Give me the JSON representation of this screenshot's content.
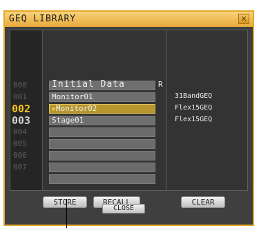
{
  "window": {
    "title": "GEQ LIBRARY"
  },
  "library": {
    "rows": [
      {
        "num": "000",
        "name": "Initial Data",
        "flag": "R",
        "type": "",
        "state": "filled"
      },
      {
        "num": "001",
        "name": "Monitor01",
        "flag": "",
        "type": "31BandGEQ",
        "state": "filled"
      },
      {
        "num": "002",
        "name": "Monitor02",
        "flag": "",
        "type": "Flex15GEQ",
        "state": "selected"
      },
      {
        "num": "003",
        "name": "Stage01",
        "flag": "",
        "type": "Flex15GEQ",
        "state": "filled"
      },
      {
        "num": "004",
        "name": "",
        "flag": "",
        "type": "",
        "state": "empty"
      },
      {
        "num": "005",
        "name": "",
        "flag": "",
        "type": "",
        "state": "empty"
      },
      {
        "num": "006",
        "name": "",
        "flag": "",
        "type": "",
        "state": "empty"
      },
      {
        "num": "007",
        "name": "",
        "flag": "",
        "type": "",
        "state": "empty"
      }
    ]
  },
  "buttons": {
    "store": "STORE",
    "recall": "RECALL",
    "clear": "CLEAR",
    "close": "CLOSE"
  },
  "colors": {
    "accent": "#e9a93a",
    "selected_row": "#b5962f",
    "active_number": "#f2c01a"
  }
}
